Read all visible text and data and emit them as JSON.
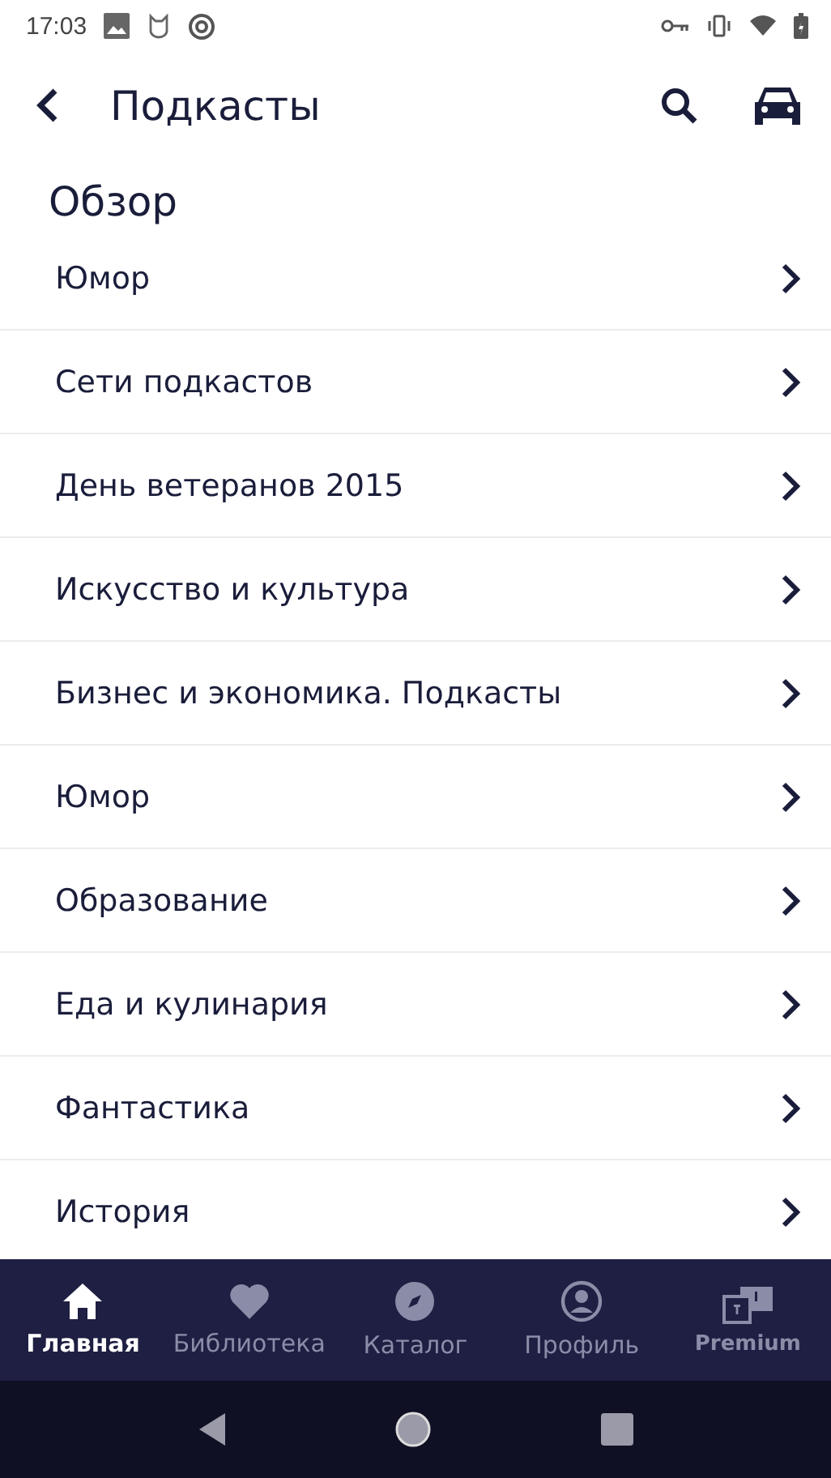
{
  "status_bar": {
    "time": "17:03"
  },
  "app_bar": {
    "title": "Подкасты"
  },
  "section": {
    "title": "Обзор"
  },
  "categories": [
    {
      "label": "Юмор"
    },
    {
      "label": "Сети подкастов"
    },
    {
      "label": "День ветеранов 2015"
    },
    {
      "label": "Искусство и культура"
    },
    {
      "label": "Бизнес и экономика. Подкасты"
    },
    {
      "label": "Юмор"
    },
    {
      "label": "Образование"
    },
    {
      "label": "Еда и кулинария"
    },
    {
      "label": "Фантастика"
    },
    {
      "label": "История"
    }
  ],
  "bottom_nav": [
    {
      "kind": "home",
      "label": "Главная",
      "selected": true
    },
    {
      "kind": "library",
      "label": "Библиотека",
      "selected": false
    },
    {
      "kind": "catalog",
      "label": "Каталог",
      "selected": false
    },
    {
      "kind": "profile",
      "label": "Профиль",
      "selected": false
    },
    {
      "kind": "premium",
      "label": "Premium",
      "selected": false
    }
  ]
}
